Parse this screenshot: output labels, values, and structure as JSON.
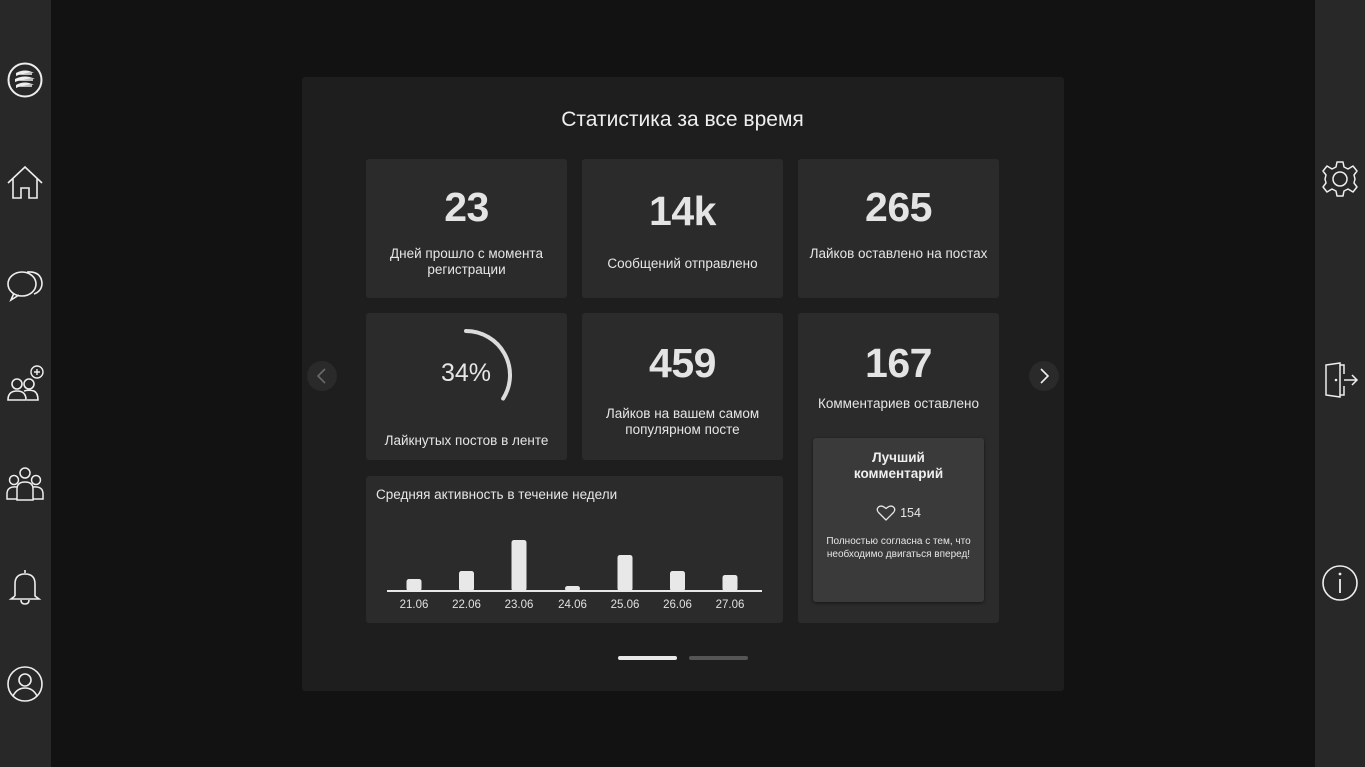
{
  "sidebar_left": {
    "items": [
      "logo-icon",
      "home-icon",
      "chat-icon",
      "add-friend-icon",
      "groups-icon",
      "bell-icon",
      "profile-icon"
    ]
  },
  "sidebar_right": {
    "items": [
      "gear-icon",
      "logout-icon",
      "info-icon"
    ]
  },
  "stats": {
    "title": "Статистика за все время",
    "days": {
      "value": "23",
      "label": "Дней прошло с момента регистрации"
    },
    "messages": {
      "value": "14k",
      "label": "Сообщений отправлено"
    },
    "likes_given": {
      "value": "265",
      "label": "Лайков оставлено на постах"
    },
    "liked_posts": {
      "value": "34%",
      "percent": 34,
      "label": "Лайкнутых постов в ленте"
    },
    "top_post": {
      "value": "459",
      "label": "Лайков на вашем самом популярном посте"
    },
    "comments": {
      "value": "167",
      "label": "Комментариев оставлено"
    },
    "best_comment": {
      "title": "Лучший комментарий",
      "likes": "154",
      "text": "Полностью согласна с тем, что необходимо двигаться вперед!"
    }
  },
  "chart_data": {
    "type": "bar",
    "title": "Средняя активность в течение недели",
    "categories": [
      "21.06",
      "22.06",
      "23.06",
      "24.06",
      "25.06",
      "26.06",
      "27.06"
    ],
    "values": [
      11,
      19,
      50,
      4,
      35,
      19,
      15
    ],
    "ylim": [
      0,
      52
    ]
  },
  "pager": {
    "pages": 2,
    "active": 1
  },
  "colors": {
    "bg": "#121212",
    "panel": "#1e1e1e",
    "card": "#2b2b2b",
    "bar": "#e8e8e8"
  }
}
